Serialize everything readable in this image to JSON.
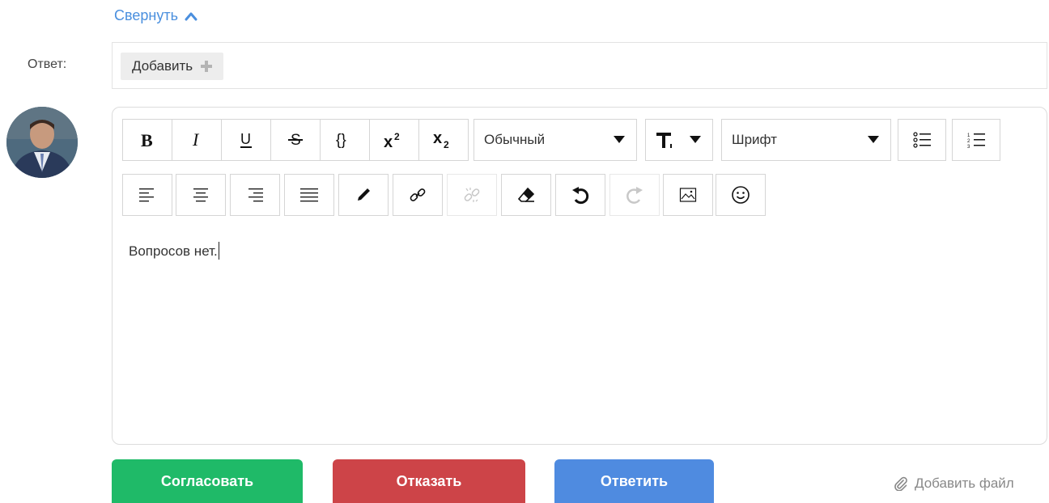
{
  "collapse_label": "Свернуть",
  "reply": {
    "label": "Ответ:",
    "add_label": "Добавить"
  },
  "toolbar": {
    "format_select": "Обычный",
    "font_select": "Шрифт"
  },
  "editor": {
    "content": "Вопросов нет."
  },
  "actions": {
    "approve": "Согласовать",
    "reject": "Отказать",
    "reply": "Ответить",
    "attach": "Добавить файл"
  },
  "colors": {
    "link": "#4a8fde",
    "approve": "#1fba68",
    "reject": "#cd4448",
    "reply": "#4f8be0"
  },
  "icons": [
    "chevron-up-icon",
    "plus-icon",
    "bold-icon",
    "italic-icon",
    "underline-icon",
    "strikethrough-icon",
    "code-braces-icon",
    "superscript-icon",
    "subscript-icon",
    "text-size-icon",
    "bullet-list-icon",
    "numbered-list-icon",
    "align-left-icon",
    "align-center-icon",
    "align-right-icon",
    "align-justify-icon",
    "pen-icon",
    "link-icon",
    "unlink-icon",
    "eraser-icon",
    "undo-icon",
    "redo-icon",
    "image-icon",
    "emoji-icon",
    "paperclip-icon"
  ]
}
